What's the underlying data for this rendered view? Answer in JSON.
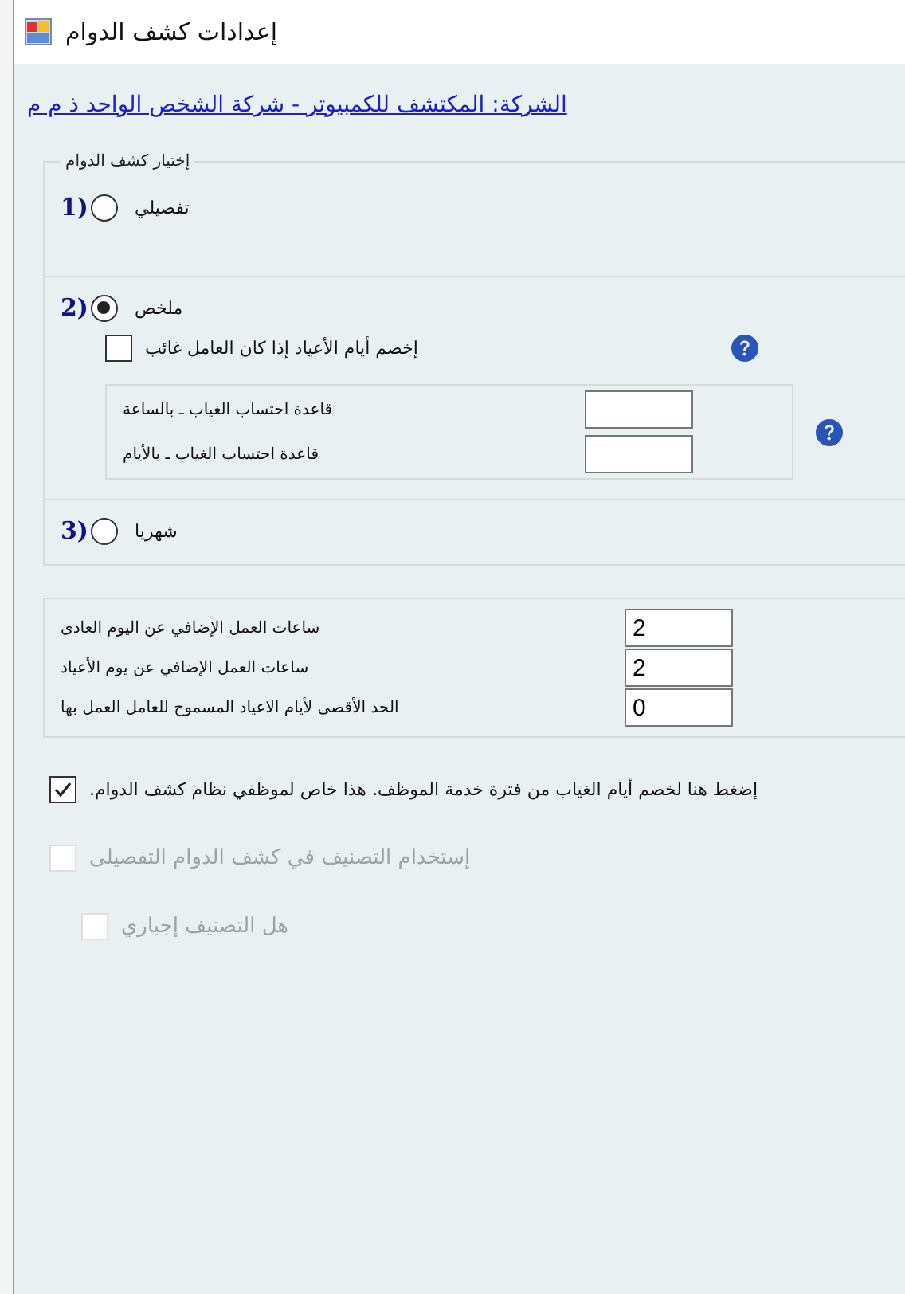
{
  "window": {
    "title": "إعدادات كشف الدوام"
  },
  "company_link": "الشركة: المكتشف للكمبيوتر - شركة الشخص الواحد ذ م م",
  "attendance_type": {
    "legend": "إختيار كشف الدوام",
    "options": [
      {
        "number": "1)",
        "label": "تفصيلي",
        "selected": false
      },
      {
        "number": "2)",
        "label": "ملخص",
        "selected": true,
        "holiday_deduct": {
          "label": "إخصم أيام الأعياد إذا كان العامل غائب",
          "checked": false
        },
        "absence_rules": [
          {
            "label": "قاعدة احتساب الغياب ـ بالساعة"
          },
          {
            "label": "قاعدة احتساب الغياب ـ بالأيام"
          }
        ]
      },
      {
        "number": "3)",
        "label": "شهريا",
        "selected": false
      }
    ]
  },
  "overtime_fields": [
    {
      "label": "ساعات العمل الإضافي عن اليوم العادى",
      "value": "2"
    },
    {
      "label": "ساعات العمل الإضافي عن يوم الأعياد",
      "value": "2"
    },
    {
      "label": "الحد الأقصى لأيام الاعياد المسموح للعامل العمل بها",
      "value": "0"
    }
  ],
  "deduct_absence": {
    "label": "إضغط هنا لخصم أيام الغياب من فترة خدمة الموظف. هذا خاص لموظفي نظام كشف الدوام.",
    "checked": true,
    "disabled": false
  },
  "use_classification": {
    "label": "إستخدام التصنيف في كشف الدوام التفصيلى",
    "checked": false,
    "disabled": true
  },
  "classification_required": {
    "label": "هل التصنيف إجباري",
    "checked": false,
    "disabled": true
  }
}
